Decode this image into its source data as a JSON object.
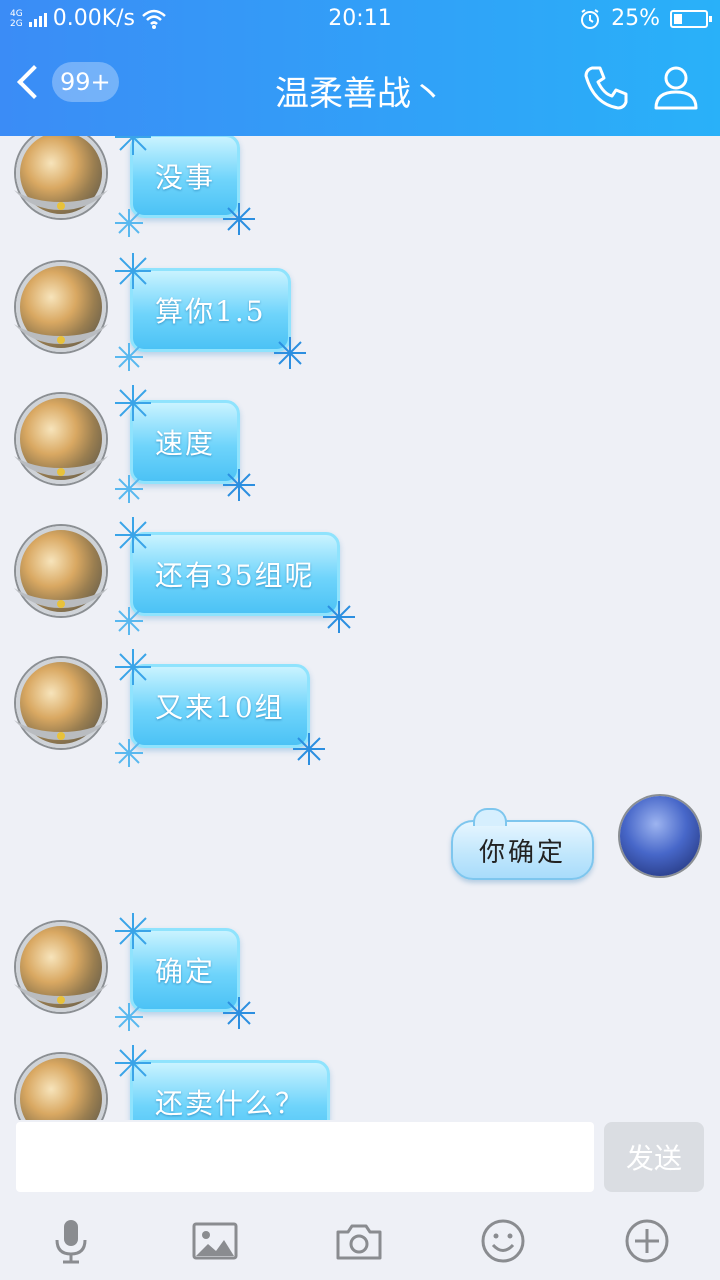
{
  "status_bar": {
    "network_type_top": "4G",
    "network_type_bottom": "2G",
    "speed": "0.00K/s",
    "time": "20:11",
    "battery": "25%",
    "battery_level": 0.25
  },
  "header": {
    "unread_count": "99+",
    "title": "温柔善战丶"
  },
  "messages": [
    {
      "side": "left",
      "text": "没事"
    },
    {
      "side": "left",
      "text": "算你1.5"
    },
    {
      "side": "left",
      "text": "速度"
    },
    {
      "side": "left",
      "text": "还有35组呢"
    },
    {
      "side": "left",
      "text": "又来10组"
    },
    {
      "side": "right",
      "text": "你确定"
    },
    {
      "side": "left",
      "text": "确定"
    },
    {
      "side": "left",
      "text": "还卖什么？"
    }
  ],
  "input": {
    "value": "",
    "send_label": "发送"
  },
  "toolbar": {
    "icons": [
      "microphone-icon",
      "image-icon",
      "camera-icon",
      "emoji-icon",
      "plus-icon"
    ]
  },
  "colors": {
    "header_start": "#3b8cf6",
    "header_end": "#29b1f9",
    "background": "#eef0f6",
    "toolbar_icon": "#8a8c90"
  }
}
